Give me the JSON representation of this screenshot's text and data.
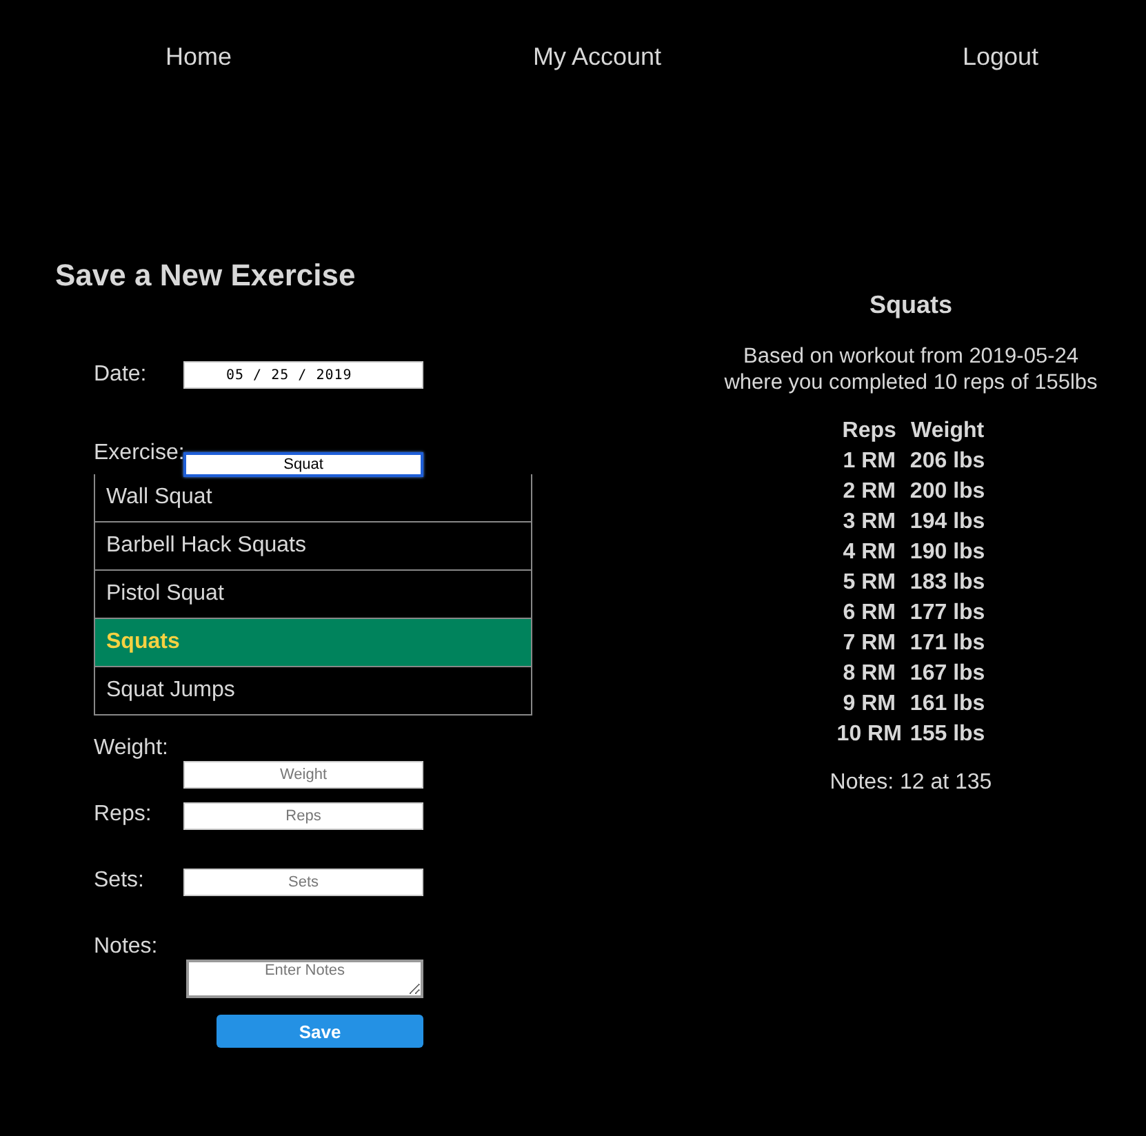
{
  "nav": [
    {
      "label": "Home"
    },
    {
      "label": "My Account"
    },
    {
      "label": "Logout"
    }
  ],
  "form": {
    "title": "Save a New Exercise",
    "date": {
      "label": "Date:",
      "value": "05 / 25 / 2019"
    },
    "exercise": {
      "label": "Exercise:",
      "value": "Squat",
      "options": [
        {
          "label": "Wall Squat",
          "selected": false
        },
        {
          "label": "Barbell Hack Squats",
          "selected": false
        },
        {
          "label": "Pistol Squat",
          "selected": false
        },
        {
          "label": "Squats",
          "selected": true
        },
        {
          "label": "Squat Jumps",
          "selected": false
        }
      ]
    },
    "fields": [
      {
        "label": "Weight:",
        "placeholder": "Weight"
      },
      {
        "label": "Reps:",
        "placeholder": "Reps"
      },
      {
        "label": "Sets:",
        "placeholder": "Sets"
      }
    ],
    "notes": {
      "label": "Notes:",
      "placeholder": "Enter Notes"
    },
    "save": "Save"
  },
  "result": {
    "title": "Squats",
    "summary": [
      "Based on workout from 2019-05-24",
      "where you completed 10 reps of 155lbs"
    ],
    "columns": [
      "Reps",
      "Weight"
    ],
    "rows": [
      [
        "1 RM",
        "206 lbs"
      ],
      [
        "2 RM",
        "200 lbs"
      ],
      [
        "3 RM",
        "194 lbs"
      ],
      [
        "4 RM",
        "190 lbs"
      ],
      [
        "5 RM",
        "183 lbs"
      ],
      [
        "6 RM",
        "177 lbs"
      ],
      [
        "7 RM",
        "171 lbs"
      ],
      [
        "8 RM",
        "167 lbs"
      ],
      [
        "9 RM",
        "161 lbs"
      ],
      [
        "10 RM",
        "155 lbs"
      ]
    ],
    "notes": "Notes: 12 at 135"
  }
}
